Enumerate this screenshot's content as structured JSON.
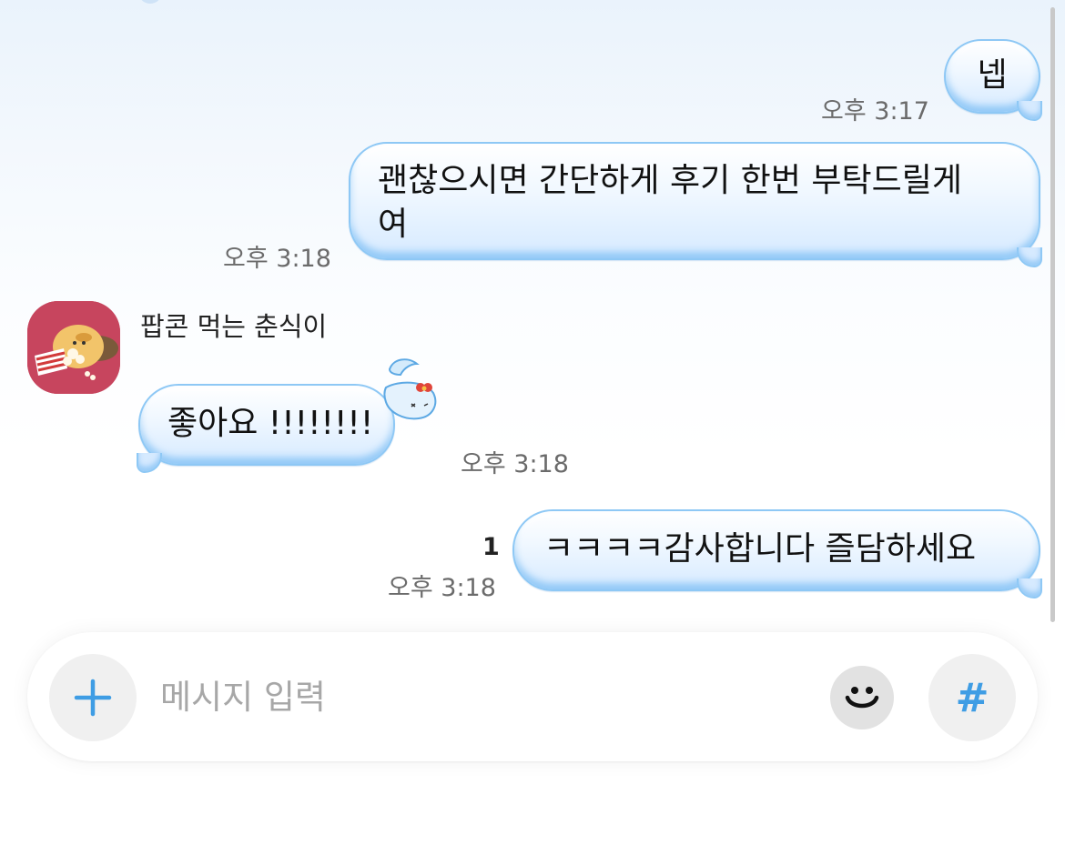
{
  "messages": [
    {
      "side": "sent",
      "text": "넵",
      "time": "오후 3:17"
    },
    {
      "side": "sent",
      "text_lines": [
        "괜찮으시면 간단하게 후기 한번 부탁드릴게",
        "여"
      ],
      "time": "오후 3:18"
    },
    {
      "side": "received",
      "sender": "팝콘 먹는 춘식이",
      "text": "좋아요 !!!!!!!!",
      "time": "오후 3:18",
      "sticker_icon": "hello-kitty-droplet-sticker"
    },
    {
      "side": "sent",
      "text": "ㅋㅋㅋㅋ감사합니다 즐담하세요",
      "time": "오후 3:18",
      "unread": "1"
    }
  ],
  "input_bar": {
    "placeholder": "메시지 입력",
    "plus_icon": "plus-icon",
    "emoji_icon": "emoji-icon",
    "hash_icon": "#"
  },
  "colors": {
    "bubble_border": "#8ec8f5",
    "bubble_fill": "#d6eaff",
    "accent_blue": "#3f9de4",
    "avatar_bg": "#c7455e"
  }
}
